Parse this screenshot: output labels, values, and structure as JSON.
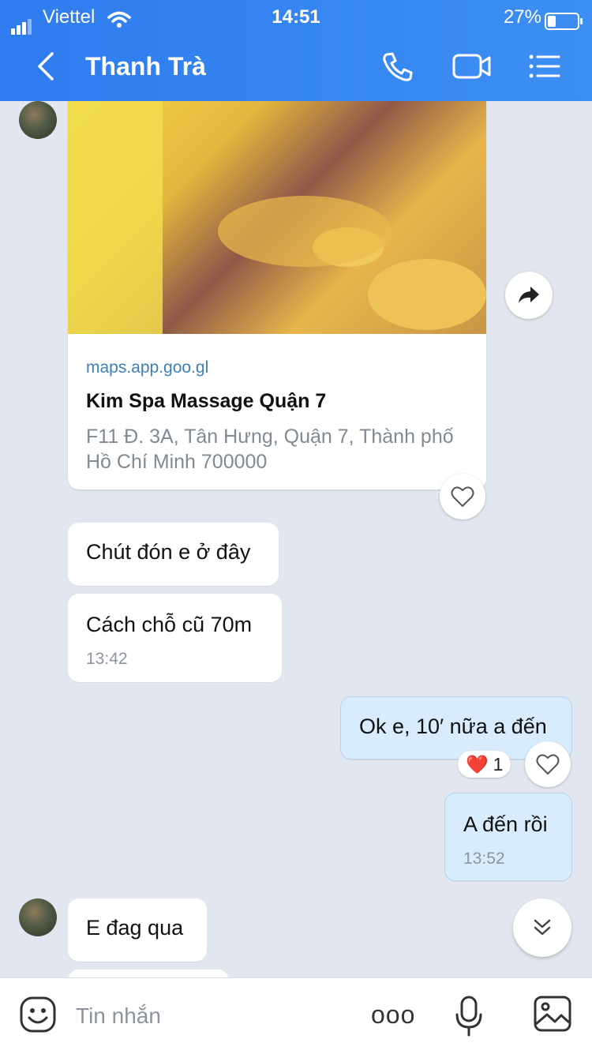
{
  "status_bar": {
    "carrier": "Viettel",
    "time": "14:51",
    "battery_percent": "27%",
    "battery_level": 0.27
  },
  "header": {
    "contact_name": "Thanh Trà"
  },
  "link_card": {
    "domain": "maps.app.goo.gl",
    "title": "Kim Spa Massage Quận 7",
    "address": "F11 Đ. 3A, Tân Hưng, Quận 7, Thành phố Hồ Chí Minh 700000"
  },
  "messages": [
    {
      "sender": "other",
      "text": "Chút đón e ở đây",
      "time": ""
    },
    {
      "sender": "other",
      "text": "Cách chỗ cũ 70m",
      "time": "13:42"
    },
    {
      "sender": "me",
      "text": "Ok e, 10′ nữa a đến",
      "time": "",
      "reaction": {
        "emoji": "❤️",
        "count": "1"
      }
    },
    {
      "sender": "me",
      "text": "A đến rồi",
      "time": "13:52"
    },
    {
      "sender": "other",
      "text": "E đag qua",
      "time": ""
    }
  ],
  "composer": {
    "placeholder": "Tin nhắn",
    "more_label": "ooo"
  },
  "colors": {
    "header": "#3a89f2",
    "bubble_mine": "#d8ecfd",
    "background": "#e2e6ee"
  }
}
